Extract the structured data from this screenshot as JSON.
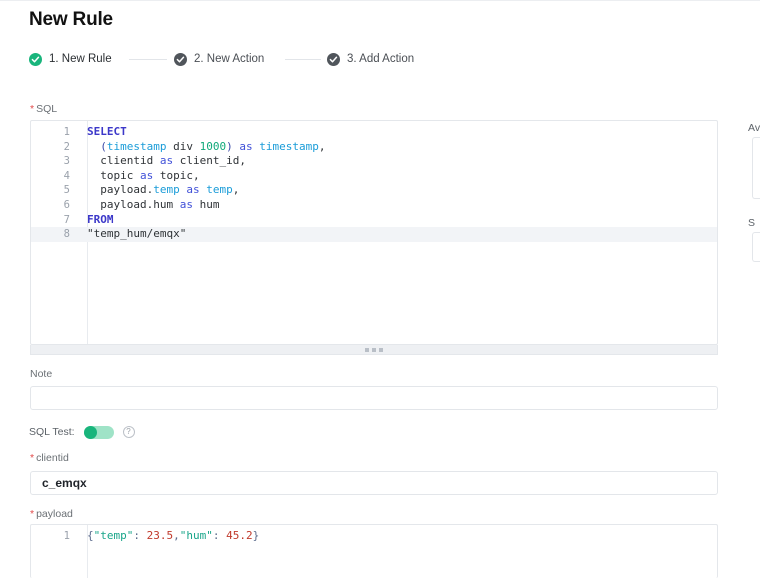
{
  "page": {
    "title": "New Rule"
  },
  "steps": [
    {
      "icon": "check-circle-filled-green",
      "label": "1. New Rule",
      "state": "done",
      "color": "#19b57c"
    },
    {
      "icon": "check-circle-filled-dark",
      "label": "2. New Action",
      "state": "done",
      "color": "#50555b"
    },
    {
      "icon": "check-circle-filled-dark",
      "label": "3. Add Action",
      "state": "done",
      "color": "#50555b"
    }
  ],
  "fields": {
    "sql": {
      "label": "SQL",
      "required": true,
      "required_marker": "*",
      "active_line": 8,
      "lines": [
        {
          "n": "1",
          "tokens": [
            {
              "t": "SELECT",
              "c": "kw"
            }
          ]
        },
        {
          "n": "2",
          "tokens": [
            {
              "t": "  (",
              "c": "pn"
            },
            {
              "t": "timestamp",
              "c": "fld"
            },
            {
              "t": " div ",
              "c": "str"
            },
            {
              "t": "1000",
              "c": "num"
            },
            {
              "t": ")",
              "c": "pn"
            },
            {
              "t": " as",
              "c": "op"
            },
            {
              "t": " ",
              "c": "str"
            },
            {
              "t": "timestamp",
              "c": "fld"
            },
            {
              "t": ",",
              "c": "str"
            }
          ]
        },
        {
          "n": "3",
          "tokens": [
            {
              "t": "  clientid",
              "c": "str"
            },
            {
              "t": " as",
              "c": "op"
            },
            {
              "t": " client_id,",
              "c": "str"
            }
          ]
        },
        {
          "n": "4",
          "tokens": [
            {
              "t": "  topic",
              "c": "str"
            },
            {
              "t": " as",
              "c": "op"
            },
            {
              "t": " topic,",
              "c": "str"
            }
          ]
        },
        {
          "n": "5",
          "tokens": [
            {
              "t": "  payload.",
              "c": "str"
            },
            {
              "t": "temp",
              "c": "fld"
            },
            {
              "t": " as",
              "c": "op"
            },
            {
              "t": " ",
              "c": "str"
            },
            {
              "t": "temp",
              "c": "fld"
            },
            {
              "t": ",",
              "c": "str"
            }
          ]
        },
        {
          "n": "6",
          "tokens": [
            {
              "t": "  payload.hum",
              "c": "str"
            },
            {
              "t": " as",
              "c": "op"
            },
            {
              "t": " hum",
              "c": "str"
            }
          ]
        },
        {
          "n": "7",
          "tokens": [
            {
              "t": "FROM",
              "c": "kw"
            }
          ]
        },
        {
          "n": "8",
          "tokens": [
            {
              "t": "\"temp_hum/emqx\"",
              "c": "str"
            }
          ]
        }
      ]
    },
    "note": {
      "label": "Note",
      "required": false,
      "value": "",
      "placeholder": ""
    },
    "sql_test": {
      "label": "SQL Test:",
      "enabled": true,
      "help_icon": "question-mark-icon",
      "help_glyph": "?"
    },
    "clientid": {
      "label": "clientid",
      "required": true,
      "required_marker": "*",
      "value": "c_emqx",
      "placeholder": ""
    },
    "payload": {
      "label": "payload",
      "required": true,
      "required_marker": "*",
      "lines": [
        {
          "n": "1",
          "tokens": [
            {
              "t": "{",
              "c": "jbrace"
            },
            {
              "t": "\"temp\"",
              "c": "jkey"
            },
            {
              "t": ": ",
              "c": "jbrace"
            },
            {
              "t": "23.5",
              "c": "jnum"
            },
            {
              "t": ",",
              "c": "jbrace"
            },
            {
              "t": "\"hum\"",
              "c": "jkey"
            },
            {
              "t": ": ",
              "c": "jbrace"
            },
            {
              "t": "45.2",
              "c": "jnum"
            },
            {
              "t": "}",
              "c": "jbrace"
            }
          ]
        }
      ]
    }
  },
  "right_panel_clipped": {
    "label_1": "Av",
    "label_2": "S"
  },
  "resize_handle": {
    "name": "editor-resize-handle",
    "dots": 3
  },
  "colors": {
    "accent_green": "#19b57c",
    "required_red": "#e24a4a",
    "border": "#e3e6ea",
    "text_primary": "#1f2329",
    "text_muted": "#6b7075",
    "active_line_bg": "#f2f4f7"
  }
}
